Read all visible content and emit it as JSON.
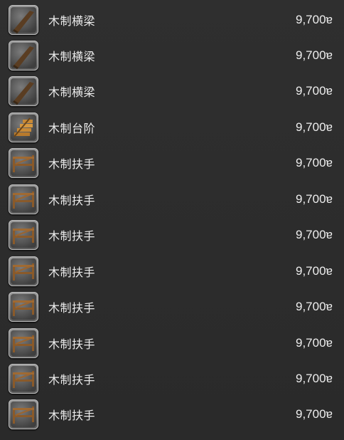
{
  "items": [
    {
      "name": "木制横梁",
      "price": "9,700ɐ",
      "icon": "wooden-beam-icon"
    },
    {
      "name": "木制横梁",
      "price": "9,700ɐ",
      "icon": "wooden-beam-icon"
    },
    {
      "name": "木制横梁",
      "price": "9,700ɐ",
      "icon": "wooden-beam-icon"
    },
    {
      "name": "木制台阶",
      "price": "9,700ɐ",
      "icon": "wooden-steps-icon"
    },
    {
      "name": "木制扶手",
      "price": "9,700ɐ",
      "icon": "wooden-railing-icon"
    },
    {
      "name": "木制扶手",
      "price": "9,700ɐ",
      "icon": "wooden-railing-icon"
    },
    {
      "name": "木制扶手",
      "price": "9,700ɐ",
      "icon": "wooden-railing-icon"
    },
    {
      "name": "木制扶手",
      "price": "9,700ɐ",
      "icon": "wooden-railing-icon"
    },
    {
      "name": "木制扶手",
      "price": "9,700ɐ",
      "icon": "wooden-railing-icon"
    },
    {
      "name": "木制扶手",
      "price": "9,700ɐ",
      "icon": "wooden-railing-icon"
    },
    {
      "name": "木制扶手",
      "price": "9,700ɐ",
      "icon": "wooden-railing-icon"
    },
    {
      "name": "木制扶手",
      "price": "9,700ɐ",
      "icon": "wooden-railing-icon"
    }
  ]
}
